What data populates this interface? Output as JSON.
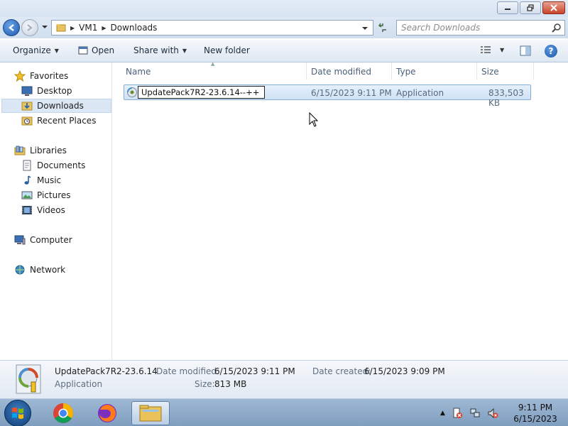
{
  "window": {
    "minimize_icon": "minimize-icon",
    "maximize_icon": "restore-icon",
    "close_icon": "close-icon"
  },
  "address": {
    "breadcrumbs": [
      "VM1",
      "Downloads"
    ],
    "search_placeholder": "Search Downloads"
  },
  "toolbar": {
    "organize_label": "Organize",
    "open_label": "Open",
    "share_label": "Share with",
    "new_folder_label": "New folder"
  },
  "sidebar": {
    "favorites": {
      "label": "Favorites",
      "items": [
        "Desktop",
        "Downloads",
        "Recent Places"
      ]
    },
    "libraries": {
      "label": "Libraries",
      "items": [
        "Documents",
        "Music",
        "Pictures",
        "Videos"
      ]
    },
    "computer_label": "Computer",
    "network_label": "Network",
    "selected": "Downloads"
  },
  "columns": [
    "Name",
    "Date modified",
    "Type",
    "Size"
  ],
  "files": [
    {
      "name_editing": "UpdatePack7R2-23.6.14--++",
      "date_modified": "6/15/2023 9:11 PM",
      "type": "Application",
      "size": "833,503 KB",
      "icon": "installer-icon"
    }
  ],
  "details": {
    "file_name": "UpdatePack7R2-23.6.14",
    "file_type": "Application",
    "date_modified_label": "Date modified:",
    "date_modified": "6/15/2023 9:11 PM",
    "date_created_label": "Date created:",
    "date_created": "6/15/2023 9:09 PM",
    "size_label": "Size:",
    "size": "813 MB"
  },
  "taskbar": {
    "pinned": [
      "chrome-icon",
      "firefox-icon",
      "explorer-icon"
    ],
    "clock_time": "9:11 PM",
    "clock_date": "6/15/2023"
  },
  "colors": {
    "selection": "#cfe2f6",
    "title_bg": "#d6e3f2",
    "taskbar": "#8aa6c6"
  }
}
